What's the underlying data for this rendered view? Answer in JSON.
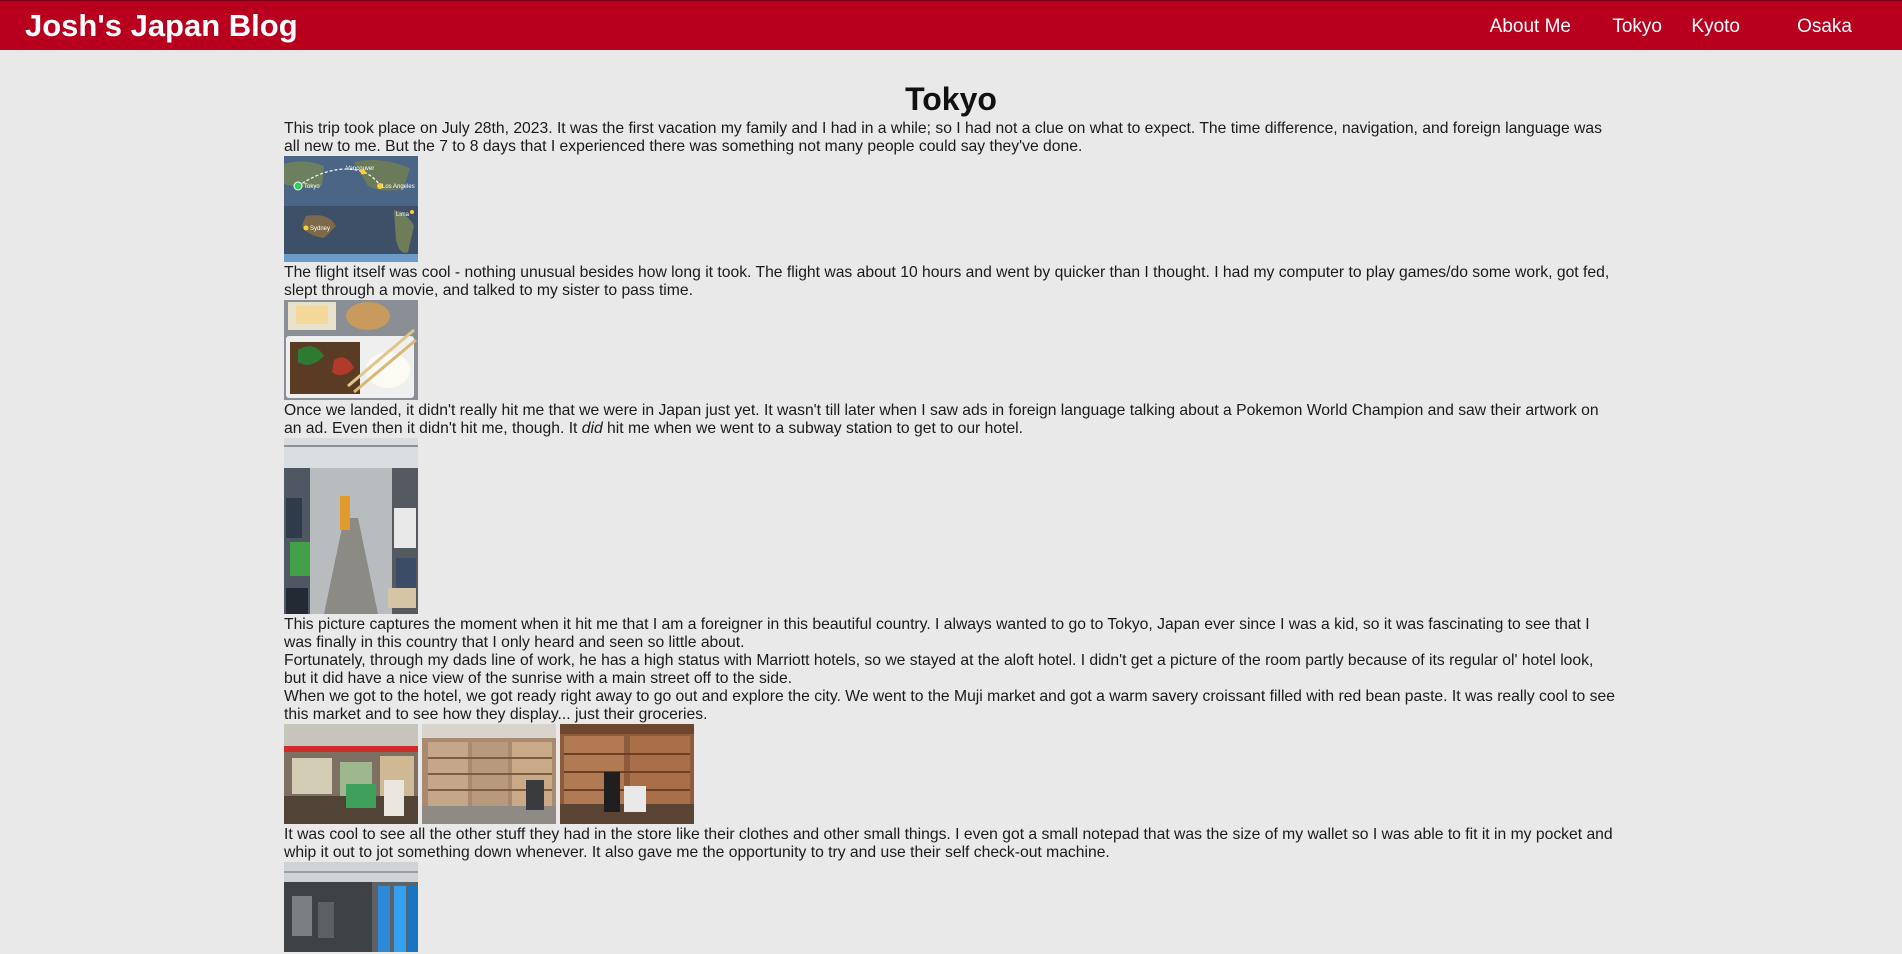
{
  "header": {
    "site_title": "Josh's Japan Blog",
    "nav": [
      "About Me",
      "Tokyo",
      "Kyoto",
      "Osaka"
    ]
  },
  "page": {
    "title": "Tokyo",
    "paragraphs": [
      "This trip took place on July 28th, 2023. It was the first vacation my family and I had in a while; so I had not a clue on what to expect. The time difference, navigation, and foreign language was all new to me. But the 7 to 8 days that I experienced there was something not many people could say they've done.",
      "The flight itself was cool - nothing unusual besides how long it took. The flight was about 10 hours and went by quicker than I thought. I had my computer to play games/do some work, got fed, slept through a movie, and talked to my sister to pass time.",
      {
        "before": "Once we landed, it didn't really hit me that we were in Japan just yet. It wasn't till later when I saw ads in foreign language talking about a Pokemon World Champion and saw their artwork on an ad. Even then it didn't hit me, though. It ",
        "emphasis": "did",
        "after": " hit me when we went to a subway station to get to our hotel."
      },
      "This picture captures the moment when it hit me that I am a foreigner in this beautiful country. I always wanted to go to Tokyo, Japan ever since I was a kid, so it was fascinating to see that I was finally in this country that I only heard and seen so little about.",
      "Fortunately, through my dads line of work, he has a high status with Marriott hotels, so we stayed at the aloft hotel. I didn't get a picture of the room partly because of its regular ol' hotel look, but it did have a nice view of the sunrise with a main street off to the side.",
      "When we got to the hotel, we got ready right away to go out and explore the city. We went to the Muji market and got a warm savery croissant filled with red bean paste. It was really cool to see this market and to see how they display... just their groceries.",
      "It was cool to see all the other stuff they had in the store like their clothes and other small things. I even got a small notepad that was the size of my wallet so I was able to fit it in my pocket and whip it out to jot something down whenever. It also gave me the opportunity to try and use their self check-out machine."
    ],
    "map_labels": [
      "Tokyo",
      "Vancouver",
      "Los Angeles",
      "Sydney",
      "Lima"
    ]
  },
  "colors": {
    "header_bg": "#b8001e",
    "page_bg": "#e9e9e9"
  }
}
